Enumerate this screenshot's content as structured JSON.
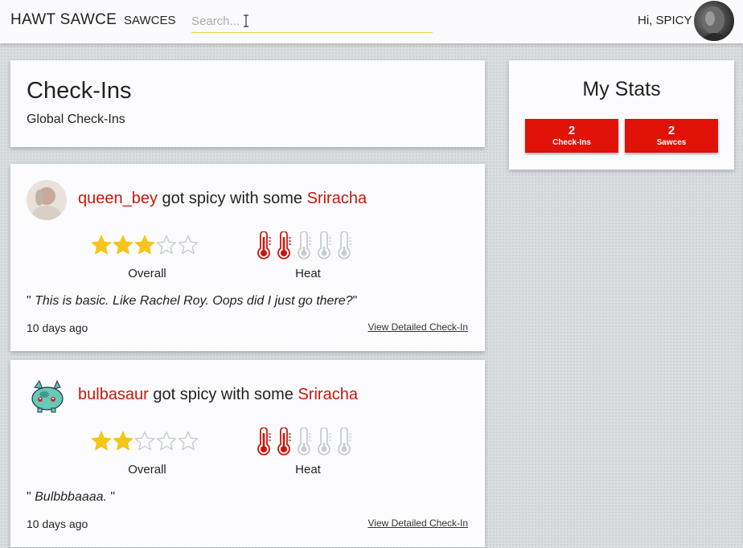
{
  "nav": {
    "brand": "HAWT SAWCE",
    "link": "SAWCES",
    "search_placeholder": "Search...",
    "greeting": "Hi, SPICY"
  },
  "header": {
    "title": "Check-Ins",
    "subtitle": "Global Check-Ins"
  },
  "stats": {
    "title": "My Stats",
    "checkins": {
      "count": "2",
      "label": "Check-Ins"
    },
    "sawces": {
      "count": "2",
      "label": "Sawces"
    }
  },
  "checkins": [
    {
      "user": "queen_bey",
      "connector": " got spicy with some ",
      "sauce": "Sriracha",
      "overall_rating": 3,
      "heat_rating": 2,
      "overall_label": "Overall",
      "heat_label": "Heat",
      "quote_open": "\" ",
      "quote": "This is basic. Like Rachel Roy. Oops did I just go there?",
      "quote_close": "\"",
      "time": "10 days ago",
      "detail_link": "View Detailed Check-In"
    },
    {
      "user": "bulbasaur",
      "connector": " got spicy with some ",
      "sauce": "Sriracha",
      "overall_rating": 2,
      "heat_rating": 2,
      "overall_label": "Overall",
      "heat_label": "Heat",
      "quote_open": "\" ",
      "quote": "Bulbbbaaaa.",
      "quote_close": " \"",
      "time": "10 days ago",
      "detail_link": "View Detailed Check-In"
    }
  ],
  "colors": {
    "accent_red": "#e01106",
    "link_red": "#c8170c",
    "star_gold": "#f5c518",
    "therm_red": "#c8170c",
    "therm_empty": "#c7ccd0"
  }
}
